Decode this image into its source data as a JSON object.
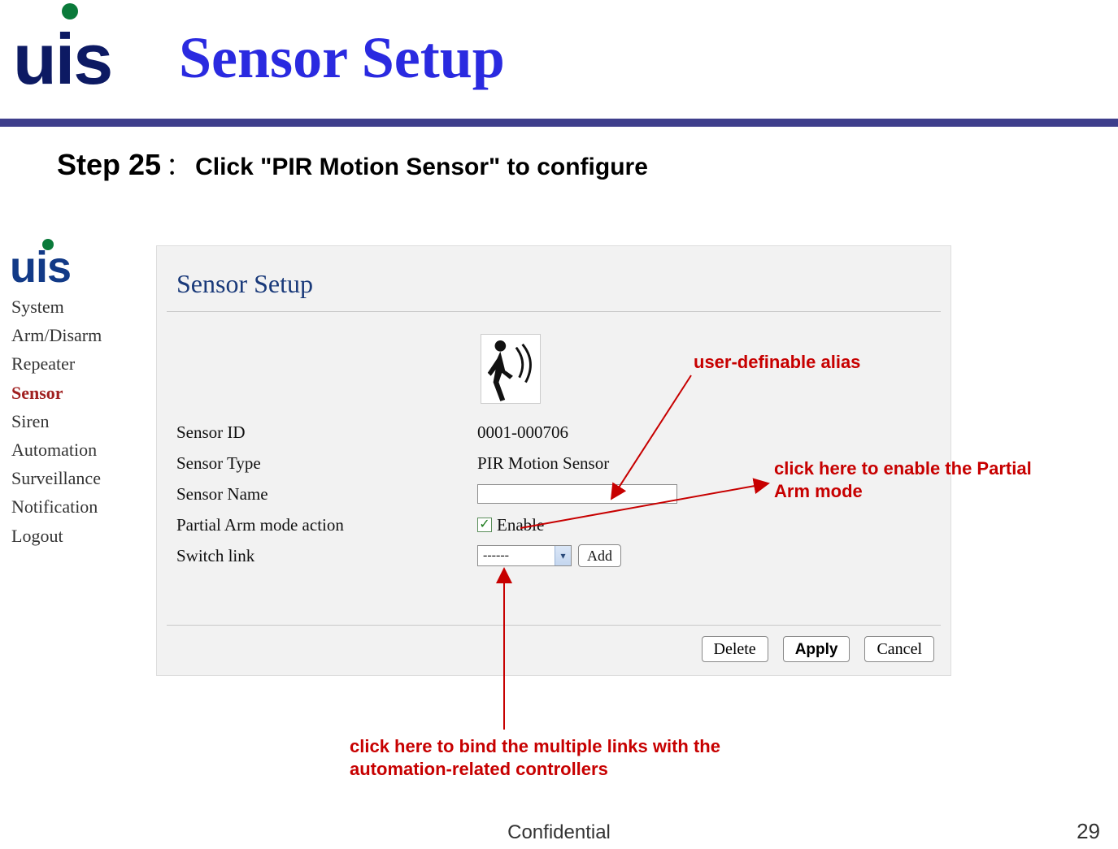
{
  "header": {
    "logo_text": "uis",
    "title": "Sensor Setup"
  },
  "step": {
    "label": "Step 25",
    "colon": "：",
    "desc": "Click \"PIR Motion Sensor\" to configure"
  },
  "panel": {
    "logo_text": "uis",
    "title": "Sensor Setup",
    "sidebar": [
      "System",
      "Arm/Disarm",
      "Repeater",
      "Sensor",
      "Siren",
      "Automation",
      "Surveillance",
      "Notification",
      "Logout"
    ],
    "active_index": 3,
    "form": {
      "sensor_id_label": "Sensor ID",
      "sensor_id_value": "0001-000706",
      "sensor_type_label": "Sensor Type",
      "sensor_type_value": "PIR Motion Sensor",
      "sensor_name_label": "Sensor Name",
      "sensor_name_value": "",
      "partial_arm_label": "Partial Arm mode action",
      "partial_arm_checkbox": "Enable",
      "switch_link_label": "Switch link",
      "switch_link_selected": "------",
      "add_label": "Add"
    },
    "buttons": {
      "delete": "Delete",
      "apply": "Apply",
      "cancel": "Cancel"
    }
  },
  "annotations": {
    "alias": "user-definable alias",
    "partial_arm": "click here to enable the Partial Arm mode",
    "switch_link": "click here to bind the multiple links with the automation-related controllers"
  },
  "footer": {
    "confidential": "Confidential",
    "page": "29"
  },
  "colors": {
    "accent_blue": "#2a2ae0",
    "brand_navy": "#0d1a63",
    "ann_red": "#c70000",
    "divider": "#3e3e8c"
  }
}
